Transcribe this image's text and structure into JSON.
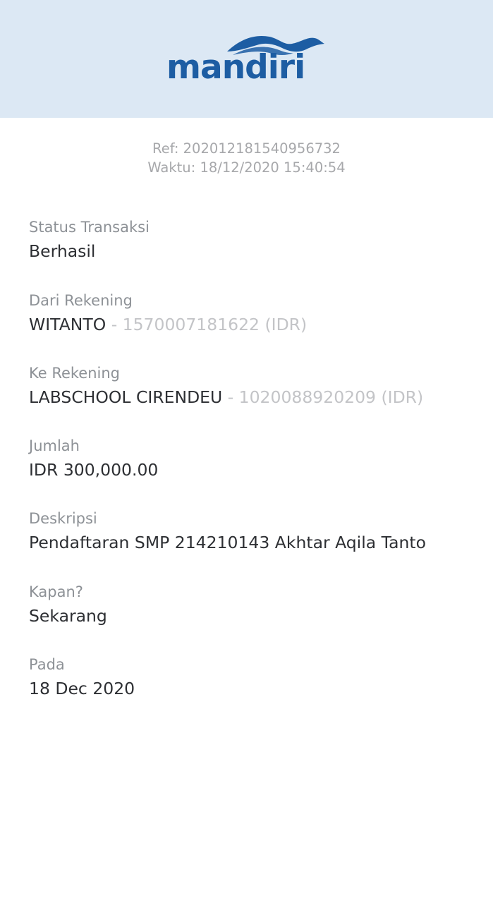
{
  "header": {
    "logo_text": "mandiri",
    "background_color": "#dce8f4",
    "brand_color": "#1d5da3"
  },
  "receipt": {
    "ref": "Ref: 202012181540956732",
    "time": "Waktu: 18/12/2020 15:40:54"
  },
  "fields": {
    "status": {
      "label": "Status Transaksi",
      "value": "Berhasil"
    },
    "from": {
      "label": "Dari Rekening",
      "name": "WITANTO",
      "account": " - 1570007181622 (IDR)"
    },
    "to": {
      "label": "Ke Rekening",
      "name": "LABSCHOOL CIRENDEU",
      "account": " - 1020088920209 (IDR)"
    },
    "amount": {
      "label": "Jumlah",
      "value": "IDR 300,000.00"
    },
    "description": {
      "label": "Deskripsi",
      "value": "Pendaftaran SMP 214210143 Akhtar Aqila Tanto"
    },
    "when": {
      "label": "Kapan?",
      "value": "Sekarang"
    },
    "date": {
      "label": "Pada",
      "value": "18 Dec 2020"
    }
  }
}
